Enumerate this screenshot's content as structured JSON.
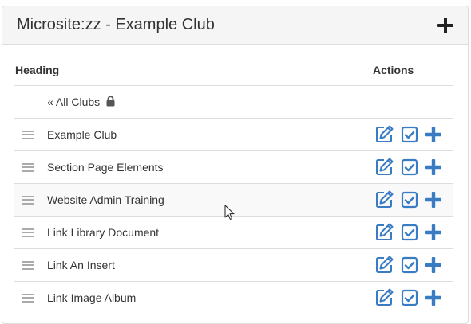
{
  "panel": {
    "title": "Microsite:zz - Example Club",
    "add_icon": "plus-icon"
  },
  "table": {
    "headers": {
      "heading": "Heading",
      "actions": "Actions"
    },
    "back_link": {
      "label": "« All Clubs",
      "icon": "lock-icon"
    },
    "rows": [
      {
        "label": "Example Club"
      },
      {
        "label": "Section Page Elements"
      },
      {
        "label": "Website Admin Training"
      },
      {
        "label": "Link Library Document"
      },
      {
        "label": "Link An Insert"
      },
      {
        "label": "Link Image Album"
      }
    ],
    "row_icons": [
      "drag-handle-icon",
      "edit-icon",
      "check-square-icon",
      "plus-icon"
    ]
  },
  "colors": {
    "accent": "#3a7cc4",
    "header_bg": "#f5f5f5",
    "border": "#dddddd",
    "text": "#333333"
  }
}
